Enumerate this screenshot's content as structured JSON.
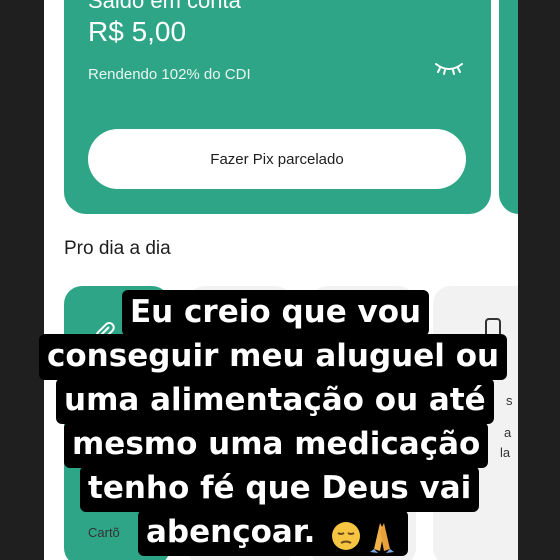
{
  "balance": {
    "label": "Saldo em conta",
    "value": "R$ 5,00",
    "yield_text": "Rendendo 102% do CDI",
    "pix_button_label": "Fazer Pix parcelado"
  },
  "section": {
    "title": "Pro dia a dia"
  },
  "tiles": {
    "partial_labels": [
      "Cartõ",
      "a",
      "la",
      "s"
    ]
  },
  "caption": {
    "lines": [
      "Eu creio que vou",
      "conseguir meu aluguel ou",
      "uma alimentação ou até",
      "mesmo uma medicação",
      "tenho fé que Deus vai",
      "abençoar."
    ],
    "emojis": [
      "pensive-face",
      "folded-hands"
    ]
  },
  "colors": {
    "accent": "#2ea586",
    "caption_bg": "#000000",
    "caption_text": "#ffffff"
  }
}
